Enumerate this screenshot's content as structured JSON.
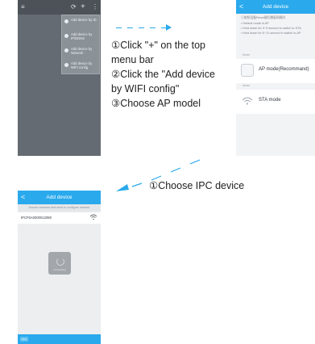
{
  "screen1": {
    "topbar_icons": [
      "back-icon",
      "refresh-icon",
      "plus-icon",
      "more-icon"
    ],
    "menu_items": [
      "Add device by ID",
      "Add device by IP/DDNS",
      "Add device by Network",
      "Add device by WIFI config"
    ]
  },
  "screen2": {
    "title": "Add device",
    "back_glyph": "<",
    "notes": [
      "①按鈕设备Reset键切换配网模式",
      "• Default mode is AP",
      "• Hold down for 3~5 second to switch to STA",
      "• Hold down for 6~11 second to switch to AP"
    ],
    "section_1": "· Mode",
    "section_2": "· Mode",
    "modes": [
      {
        "label": "AP mode(Recommand)",
        "icon": "ap-mode-icon"
      },
      {
        "label": "STA mode",
        "icon": "wifi-icon"
      }
    ]
  },
  "instructions": {
    "step1_line1": "①Click \"+\" on the top",
    "step1_line2": "menu bar",
    "step2_line1": "②Click the \"Add device",
    "step2_line2": "by WIFI config\"",
    "step3": "③Choose AP model",
    "step4": "①Choose IPC device"
  },
  "screen3": {
    "title": "Add device",
    "back_glyph": "<",
    "hint": "choose cameras that need to configure network",
    "device_name": "IPCF5A0000012080",
    "wifi_icon": "wifi-icon",
    "loading_text": "Connecting",
    "next_label": "Next"
  },
  "colors": {
    "accent": "#2aa9ec",
    "dark_bg": "#646b72"
  }
}
